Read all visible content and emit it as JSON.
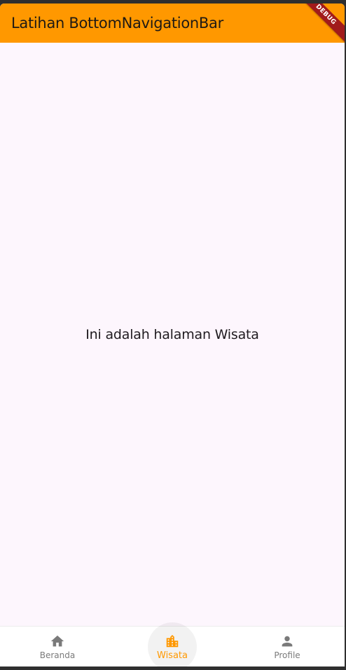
{
  "appbar": {
    "title": "Latihan BottomNavigationBar",
    "debug_banner": "DEBUG",
    "color": "#ff9800"
  },
  "content": {
    "text": "Ini adalah halaman Wisata"
  },
  "bottom_nav": {
    "items": [
      {
        "label": "Beranda",
        "icon": "home-icon",
        "active": false
      },
      {
        "label": "Wisata",
        "icon": "location-city-icon",
        "active": true
      },
      {
        "label": "Profile",
        "icon": "person-icon",
        "active": false
      }
    ],
    "active_color": "#ff9800",
    "inactive_color": "#7a7a7a"
  }
}
